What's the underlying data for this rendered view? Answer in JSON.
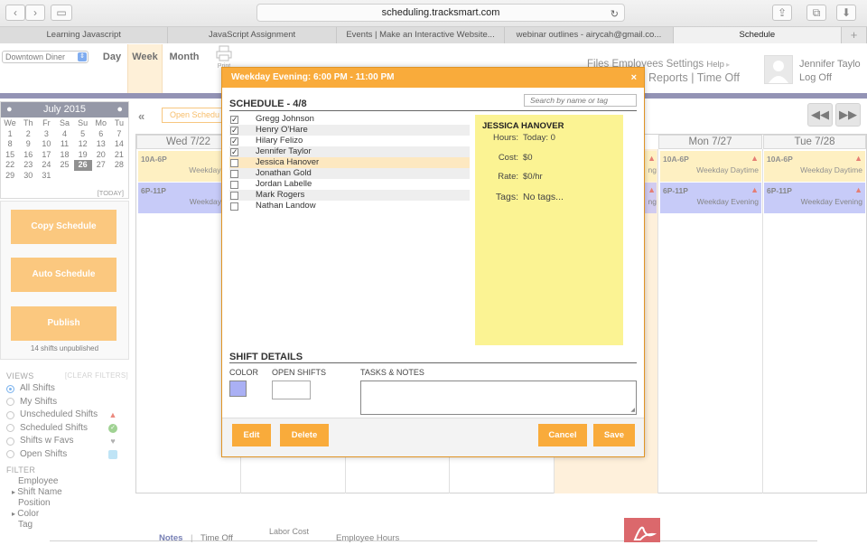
{
  "browser": {
    "url": "scheduling.tracksmart.com",
    "tabs": [
      "Learning Javascript",
      "JavaScript Assignment",
      "Events | Make an Interactive Website...",
      "webinar outlines - airycah@gmail.co...",
      "Schedule"
    ],
    "plus": "+"
  },
  "header": {
    "location": "Downtown Diner",
    "views": [
      "Day",
      "Week",
      "Month"
    ],
    "print": "Print",
    "nav": [
      "Files",
      "Employees",
      "Settings",
      "Help"
    ],
    "nav2": [
      "Reports",
      "Time Off"
    ],
    "user": "Jennifer Taylo",
    "logoff": "Log Off"
  },
  "calendar": {
    "month": "July 2015",
    "weekdays": [
      "We",
      "Th",
      "Fr",
      "Sa",
      "Su",
      "Mo",
      "Tu"
    ],
    "days": [
      "1",
      "2",
      "3",
      "4",
      "5",
      "6",
      "7",
      "8",
      "9",
      "10",
      "11",
      "12",
      "13",
      "14",
      "15",
      "16",
      "17",
      "18",
      "19",
      "20",
      "21",
      "22",
      "23",
      "24",
      "25",
      "26",
      "27",
      "28",
      "29",
      "30",
      "31"
    ],
    "today_day": "26",
    "today_btn": "[TODAY]"
  },
  "sidebar": {
    "copy": "Copy Schedule",
    "auto": "Auto Schedule",
    "publish": "Publish",
    "unpublished": "14 shifts unpublished",
    "views_hdr": "VIEWS",
    "clear": "[CLEAR FILTERS]",
    "views": [
      "All Shifts",
      "My Shifts",
      "Unscheduled Shifts",
      "Scheduled Shifts",
      "Shifts w Favs",
      "Open Shifts"
    ],
    "filter_hdr": "FILTER",
    "filters": [
      "Employee",
      "Shift Name",
      "Position",
      "Color",
      "Tag"
    ]
  },
  "schedule": {
    "open_shifts": "Open Schedu",
    "columns": [
      "Wed 7/22",
      "Mon 7/27",
      "Tue 7/28"
    ],
    "day_time": "10A-6P",
    "day_name": "Weekday Daytime",
    "day_name_cut": "Weekday Day",
    "eve_time": "6P-11P",
    "eve_name": "Weekday Evening",
    "eve_name_cut": "Weekday Eve",
    "peek": "ng",
    "accent": "#f9ab3b",
    "shift_yellow": "#fde8a2",
    "shift_purple": "#aab0f4"
  },
  "footer": {
    "notes": "Notes",
    "timeoff": "Time Off",
    "labor": "Labor Cost",
    "hours": "Employee Hours"
  },
  "modal": {
    "title": "Weekday Evening: 6:00 PM - 11:00 PM",
    "close": "×",
    "schedule_hdr": "SCHEDULE - 4/8",
    "search_placeholder": "Search by name or tag",
    "employees": [
      {
        "name": "Gregg Johnson",
        "checked": true
      },
      {
        "name": "Henry O'Hare",
        "checked": true
      },
      {
        "name": "Hilary Felizo",
        "checked": true
      },
      {
        "name": "Jennifer Taylor",
        "checked": true
      },
      {
        "name": "Jessica Hanover",
        "checked": false
      },
      {
        "name": "Jonathan Gold",
        "checked": false
      },
      {
        "name": "Jordan Labelle",
        "checked": false
      },
      {
        "name": "Mark Rogers",
        "checked": false
      },
      {
        "name": "Nathan Landow",
        "checked": false
      }
    ],
    "detail": {
      "name": "JESSICA HANOVER",
      "hours_k": "Hours:",
      "hours_v": "Today: 0",
      "cost_k": "Cost:",
      "cost_v": "$0",
      "rate_k": "Rate:",
      "rate_v": "$0/hr",
      "tags_k": "Tags:",
      "tags_v": "No tags..."
    },
    "shift_details": "SHIFT DETAILS",
    "color_lbl": "COLOR",
    "open_lbl": "OPEN SHIFTS",
    "tasks_lbl": "TASKS & NOTES",
    "edit": "Edit",
    "delete": "Delete",
    "cancel": "Cancel",
    "save": "Save"
  }
}
